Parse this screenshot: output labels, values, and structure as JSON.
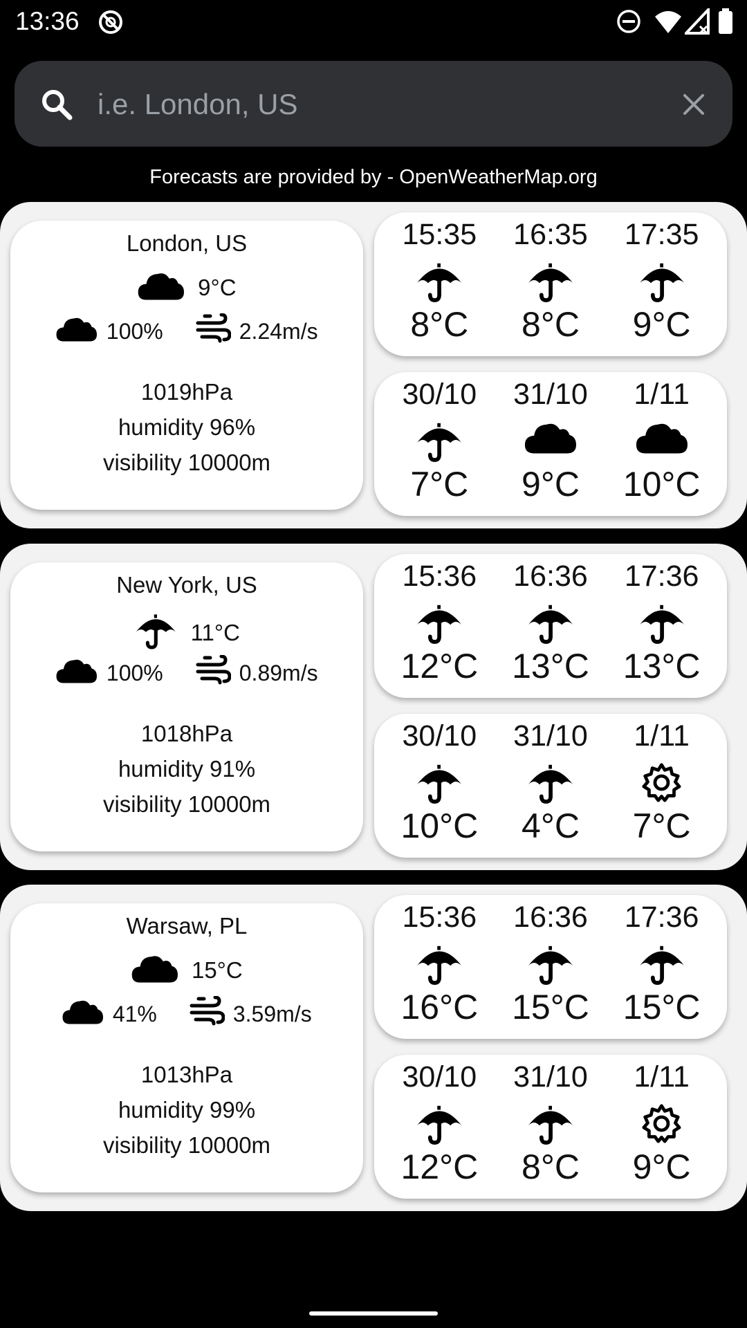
{
  "status_bar": {
    "time": "13:36",
    "icons": [
      "no-disturb-app-icon",
      "do-not-disturb-icon",
      "wifi-icon",
      "signal-icon",
      "battery-icon"
    ]
  },
  "search": {
    "placeholder": "i.e. London, US",
    "value": "",
    "icon": "search-icon",
    "clear_icon": "close-icon"
  },
  "attribution": "Forecasts are provided by - OpenWeatherMap.org",
  "cities": [
    {
      "name": "London, US",
      "current_icon": "cloud-icon",
      "temp": "9°C",
      "cloudiness": "100%",
      "wind": "2.24m/s",
      "pressure": "1019hPa",
      "humidity": "humidity 96%",
      "visibility": "visibility 10000m",
      "hourly": [
        {
          "label": "15:35",
          "icon": "umbrella-icon",
          "temp": "8°C"
        },
        {
          "label": "16:35",
          "icon": "umbrella-icon",
          "temp": "8°C"
        },
        {
          "label": "17:35",
          "icon": "umbrella-icon",
          "temp": "9°C"
        }
      ],
      "daily": [
        {
          "label": "30/10",
          "icon": "umbrella-icon",
          "temp": "7°C"
        },
        {
          "label": "31/10",
          "icon": "cloud-icon",
          "temp": "9°C"
        },
        {
          "label": "1/11",
          "icon": "cloud-icon",
          "temp": "10°C"
        }
      ]
    },
    {
      "name": "New York, US",
      "current_icon": "umbrella-icon",
      "temp": "11°C",
      "cloudiness": "100%",
      "wind": "0.89m/s",
      "pressure": "1018hPa",
      "humidity": "humidity 91%",
      "visibility": "visibility 10000m",
      "hourly": [
        {
          "label": "15:36",
          "icon": "umbrella-icon",
          "temp": "12°C"
        },
        {
          "label": "16:36",
          "icon": "umbrella-icon",
          "temp": "13°C"
        },
        {
          "label": "17:36",
          "icon": "umbrella-icon",
          "temp": "13°C"
        }
      ],
      "daily": [
        {
          "label": "30/10",
          "icon": "umbrella-icon",
          "temp": "10°C"
        },
        {
          "label": "31/10",
          "icon": "umbrella-icon",
          "temp": "4°C"
        },
        {
          "label": "1/11",
          "icon": "sun-icon",
          "temp": "7°C"
        }
      ]
    },
    {
      "name": "Warsaw, PL",
      "current_icon": "cloud-icon",
      "temp": "15°C",
      "cloudiness": "41%",
      "wind": "3.59m/s",
      "pressure": "1013hPa",
      "humidity": "humidity 99%",
      "visibility": "visibility 10000m",
      "hourly": [
        {
          "label": "15:36",
          "icon": "umbrella-icon",
          "temp": "16°C"
        },
        {
          "label": "16:36",
          "icon": "umbrella-icon",
          "temp": "15°C"
        },
        {
          "label": "17:36",
          "icon": "umbrella-icon",
          "temp": "15°C"
        }
      ],
      "daily": [
        {
          "label": "30/10",
          "icon": "umbrella-icon",
          "temp": "12°C"
        },
        {
          "label": "31/10",
          "icon": "umbrella-icon",
          "temp": "8°C"
        },
        {
          "label": "1/11",
          "icon": "sun-icon",
          "temp": "9°C"
        }
      ]
    }
  ]
}
